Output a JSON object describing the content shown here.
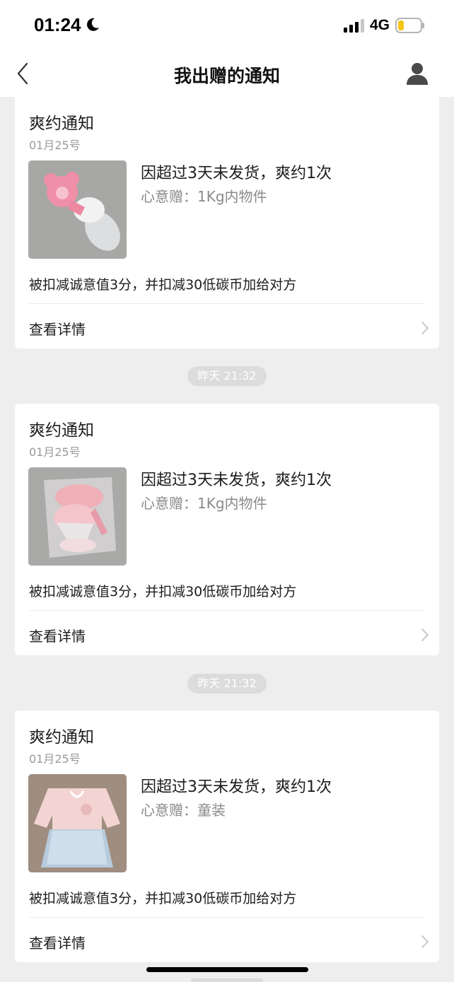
{
  "status": {
    "time": "01:24",
    "network": "4G"
  },
  "nav": {
    "title": "我出赠的通知"
  },
  "notifications": [
    {
      "title": "爽约通知",
      "date": "01月25号",
      "reason": "因超过3天未发货，爽约1次",
      "gift": "心意赠：1Kg内物件",
      "penalty": "被扣减诚意值3分，并扣减30低碳币加给对方",
      "details_label": "查看详情",
      "image_icon": "teether-toy-icon"
    },
    {
      "title": "爽约通知",
      "date": "01月25号",
      "reason": "因超过3天未发货，爽约1次",
      "gift": "心意赠：1Kg内物件",
      "penalty": "被扣减诚意值3分，并扣减30低碳币加给对方",
      "details_label": "查看详情",
      "image_icon": "pacifier-bag-icon"
    },
    {
      "title": "爽约通知",
      "date": "01月25号",
      "reason": "因超过3天未发货，爽约1次",
      "gift": "心意赠：童装",
      "penalty": "被扣减诚意值3分，并扣减30低碳币加给对方",
      "details_label": "查看详情",
      "image_icon": "baby-dress-icon"
    }
  ],
  "timestamps": [
    "昨天 21:32",
    "昨天 21:32"
  ],
  "colors": {
    "background": "#eeeeee",
    "card": "#ffffff",
    "pill": "#dcdcdc",
    "battery": "#f5c518"
  }
}
